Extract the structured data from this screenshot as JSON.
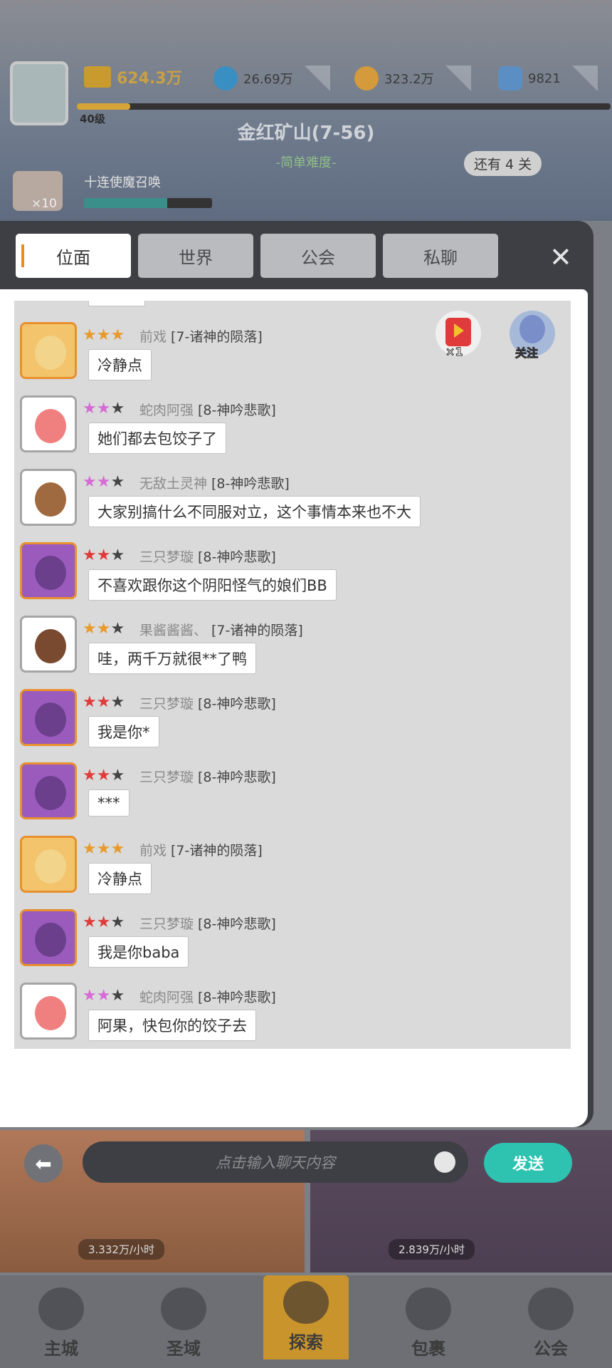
{
  "hud": {
    "power": "624.3万",
    "water": "26.69万",
    "gold": "323.2万",
    "gem": "9821",
    "level": "40级",
    "stage": "金红矿山(7-56)",
    "difficulty": "-简单难度-",
    "remaining": "还有 4 关",
    "summon_title": "十连使魔召唤",
    "summon_count": "×10"
  },
  "chat": {
    "tabs": [
      "位面",
      "世界",
      "公会",
      "私聊"
    ],
    "active_tab": "位面",
    "floats": {
      "gift_count": "×1",
      "follow_label": "关注"
    },
    "messages": [
      {
        "name": "前戏",
        "group": "[7-诸神的陨落]",
        "text": "冷静点"
      },
      {
        "name": "蛇肉阿强",
        "group": "[8-神吟悲歌]",
        "text": "她们都去包饺子了"
      },
      {
        "name": "无敌土灵神",
        "group": "[8-神吟悲歌]",
        "text": "大家别搞什么不同服对立，这个事情本来也不大"
      },
      {
        "name": "三只梦璇",
        "group": "[8-神吟悲歌]",
        "text": "不喜欢跟你这个阴阳怪气的娘们BB"
      },
      {
        "name": "果酱酱酱、",
        "group": "[7-诸神的陨落]",
        "text": "哇，两千万就很**了鸭"
      },
      {
        "name": "三只梦璇",
        "group": "[8-神吟悲歌]",
        "text": "我是你*"
      },
      {
        "name": "三只梦璇",
        "group": "[8-神吟悲歌]",
        "text": "***"
      },
      {
        "name": "前戏",
        "group": "[7-诸神的陨落]",
        "text": "冷静点"
      },
      {
        "name": "三只梦璇",
        "group": "[8-神吟悲歌]",
        "text": "我是你baba"
      },
      {
        "name": "蛇肉阿强",
        "group": "[8-神吟悲歌]",
        "text": "阿果，快包你的饺子去"
      }
    ],
    "input_placeholder": "点击输入聊天内容",
    "send_label": "发送"
  },
  "scene": {
    "rate_left": "3.332万/小时",
    "rate_right": "2.839万/小时"
  },
  "nav": [
    "主城",
    "圣域",
    "探索",
    "包裹",
    "公会"
  ],
  "colors": {
    "accent": "#2ec3b0",
    "tab_marker": "#e88d1f"
  }
}
